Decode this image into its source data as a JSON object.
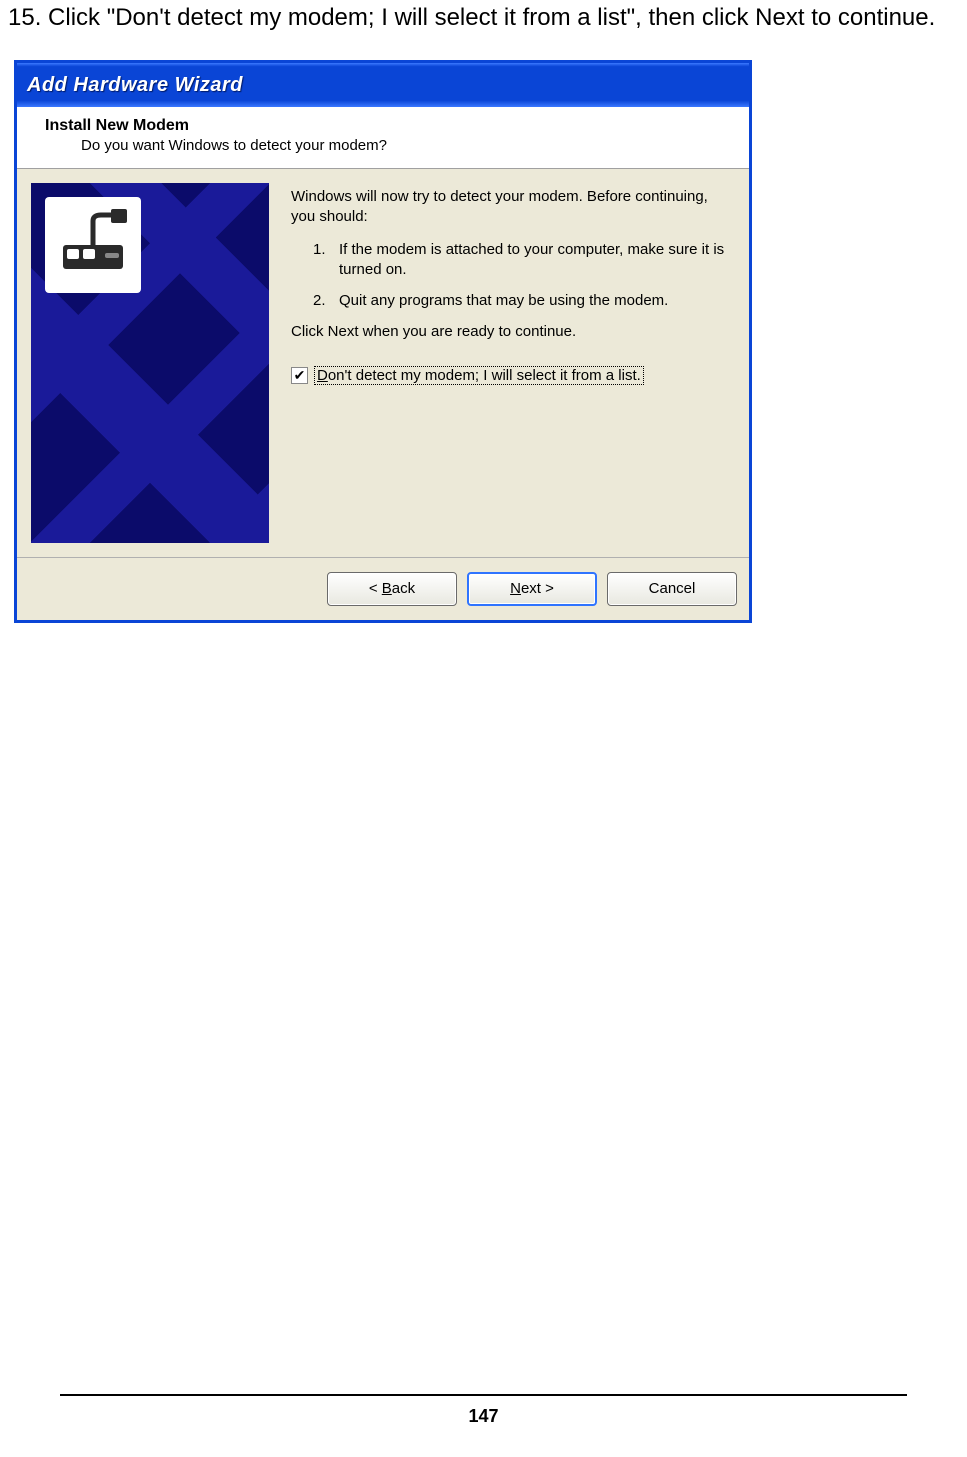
{
  "instruction": "15. Click \"Don't detect my modem; I will select it from a list\", then click Next to continue.",
  "window": {
    "title": "Add Hardware Wizard",
    "header_title": "Install New Modem",
    "header_sub": "Do you want Windows to detect your modem?",
    "intro": "Windows will now try to detect your modem.  Before continuing, you should:",
    "steps": [
      {
        "num": "1.",
        "text": "If the modem is attached to your computer, make sure it is turned on."
      },
      {
        "num": "2.",
        "text": "Quit any programs that may be using the modem."
      }
    ],
    "closing": "Click Next when you are ready to continue.",
    "checkbox": {
      "checked": true,
      "hotkey": "D",
      "rest": "on't detect my modem; I will select it from a list."
    },
    "buttons": {
      "back_hotkey": "B",
      "back_rest": "ack",
      "next_hotkey": "N",
      "next_rest": "ext >",
      "cancel": "Cancel"
    }
  },
  "page_number": "147"
}
